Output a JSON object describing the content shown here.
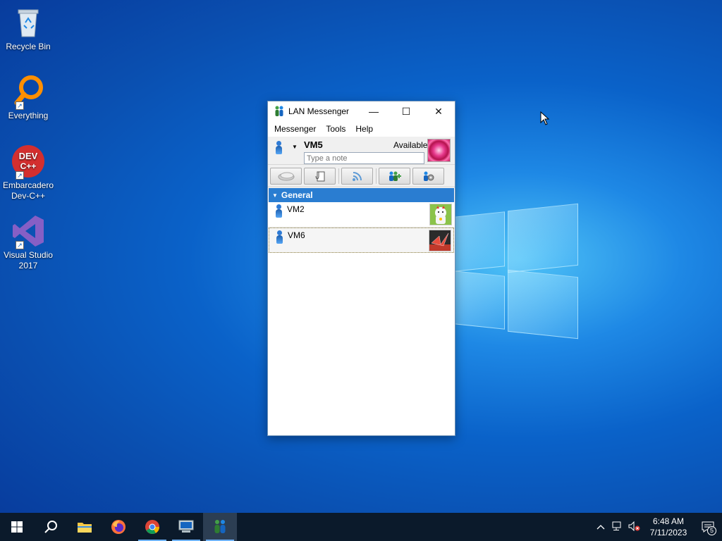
{
  "desktop": {
    "icons": [
      {
        "label": "Recycle Bin",
        "icon": "recycle-bin-icon"
      },
      {
        "label": "Everything",
        "icon": "everything-search-icon"
      },
      {
        "label": "Embarcadero Dev-C++",
        "icon": "devcpp-icon",
        "badge": "DEV C++"
      },
      {
        "label": "Visual Studio 2017",
        "icon": "visual-studio-icon"
      }
    ]
  },
  "window": {
    "title": "LAN Messenger",
    "controls": {
      "minimize": "—",
      "maximize": "☐",
      "close": "✕"
    },
    "menu": [
      "Messenger",
      "Tools",
      "Help"
    ],
    "user": {
      "name": "VM5",
      "status": "Available",
      "note_placeholder": "Type a note"
    },
    "toolbar": [
      "chat-button",
      "file-transfer-button",
      "broadcast-button",
      "add-contact-button",
      "settings-button"
    ],
    "group": {
      "name": "General"
    },
    "contacts": [
      {
        "name": "VM2",
        "avatar": "lucky-cat-avatar",
        "selected": false
      },
      {
        "name": "VM6",
        "avatar": "paper-crane-avatar",
        "selected": true
      }
    ]
  },
  "taskbar": {
    "clock": {
      "time": "6:48 AM",
      "date": "7/11/2023"
    },
    "notifications": "5"
  }
}
